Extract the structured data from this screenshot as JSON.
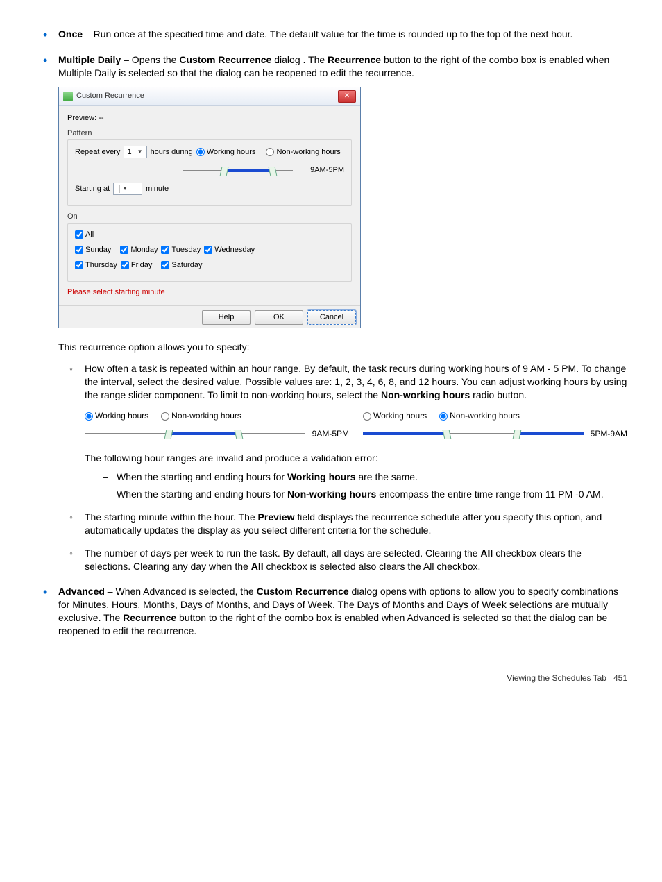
{
  "bullet_once": {
    "term": "Once",
    "text": " – Run once at the specified time and date. The default value for the time is rounded up to the top of the next hour."
  },
  "bullet_multiple": {
    "term": "Multiple Daily",
    "text_a": " – Opens the ",
    "bold_a": "Custom Recurrence",
    "text_b": " dialog . The ",
    "bold_b": "Recurrence",
    "text_c": " button to the right of the combo box is enabled when Multiple Daily is selected so that the dialog can be reopened to edit the recurrence."
  },
  "dialog": {
    "title": "Custom Recurrence",
    "preview_label": "Preview:  --",
    "pattern_label": "Pattern",
    "repeat_every": "Repeat every",
    "repeat_value": "1",
    "hours_during": "hours during",
    "working_hours": "Working hours",
    "nonworking_hours": "Non-working hours",
    "range_label": "9AM-5PM",
    "starting_at": "Starting at",
    "minute": "minute",
    "on_label": "On",
    "all": "All",
    "days": {
      "sun": "Sunday",
      "mon": "Monday",
      "tue": "Tuesday",
      "wed": "Wednesday",
      "thu": "Thursday",
      "fri": "Friday",
      "sat": "Saturday"
    },
    "error": "Please select starting minute",
    "help": "Help",
    "ok": "OK",
    "cancel": "Cancel"
  },
  "para_specify": "This recurrence option allows you to specify:",
  "circ1_a": "How often a task is repeated within an hour range. By default, the task recurs during working hours of 9 AM - 5 PM. To change the interval, select the desired value. Possible values are: 1, 2, 3, 4, 6, 8, and 12 hours. You can adjust working hours by using the range slider component. To limit to non-working hours, select the ",
  "circ1_bold": "Non-working hours",
  "circ1_b": " radio button.",
  "radio_panels": {
    "left": {
      "working": "Working hours",
      "nonworking": "Non-working hours",
      "range": "9AM-5PM"
    },
    "right": {
      "working": "Working hours",
      "nonworking": "Non-working hours",
      "range": "5PM-9AM"
    }
  },
  "invalid_intro": "The following hour ranges are invalid and produce a validation error:",
  "dash1_a": "When the starting and ending hours for ",
  "dash1_bold": "Working hours",
  "dash1_b": " are the same.",
  "dash2_a": "When the starting and ending hours for ",
  "dash2_bold": "Non-working hours",
  "dash2_b": " encompass the entire time range from 11 PM -0 AM.",
  "circ2_a": "The starting minute within the hour. The ",
  "circ2_bold": "Preview",
  "circ2_b": " field displays the recurrence schedule after you specify this option, and automatically updates the display as you select different criteria for the schedule.",
  "circ3_a": "The number of days per week to run the task. By default, all days are selected. Clearing the ",
  "circ3_bold1": "All",
  "circ3_b": " checkbox clears the selections. Clearing any day when the ",
  "circ3_bold2": "All",
  "circ3_c": " checkbox is selected also clears the All checkbox.",
  "bullet_advanced": {
    "term": "Advanced",
    "a": " – When Advanced is selected, the ",
    "b1": "Custom Recurrence",
    "b": " dialog opens with options to allow you to specify combinations for Minutes, Hours, Months, Days of Months, and Days of Week. The Days of Months and Days of Week selections are mutually exclusive. The ",
    "b2": "Recurrence",
    "c": " button to the right of the combo box is enabled when Advanced is selected so that the dialog can be reopened to edit the recurrence."
  },
  "footer_text": "Viewing the Schedules Tab",
  "footer_page": "451"
}
